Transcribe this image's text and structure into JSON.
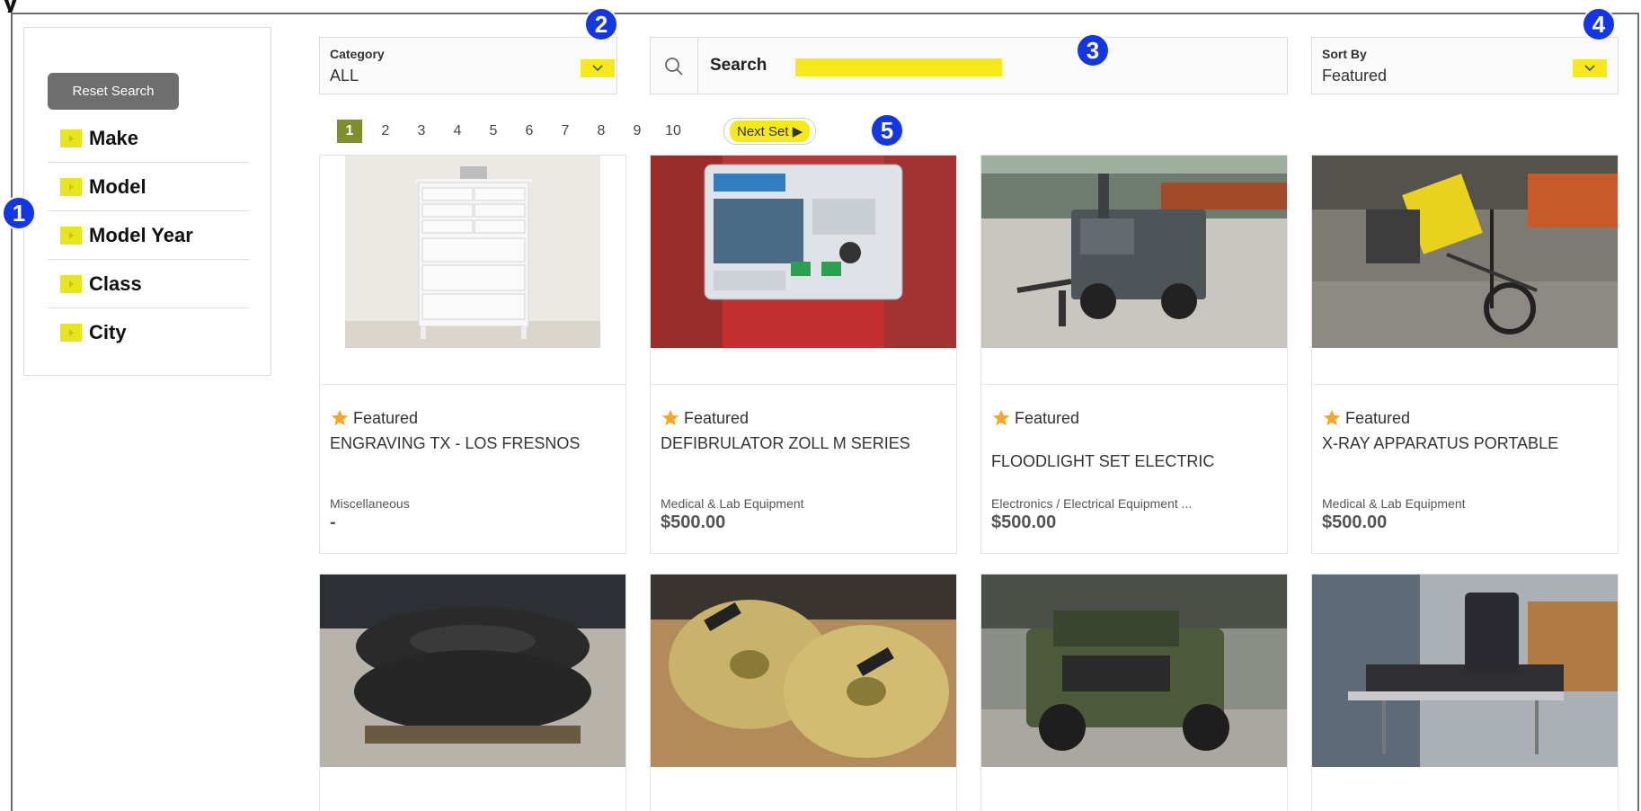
{
  "callouts": [
    "1",
    "2",
    "3",
    "4",
    "5"
  ],
  "sidebar": {
    "reset_label": "Reset Search",
    "filters": [
      {
        "label": "Make"
      },
      {
        "label": "Model"
      },
      {
        "label": "Model Year"
      },
      {
        "label": "Class"
      },
      {
        "label": "City"
      }
    ]
  },
  "category": {
    "caption": "Category",
    "value": "ALL"
  },
  "search": {
    "placeholder": "Search"
  },
  "sort": {
    "caption": "Sort By",
    "value": "Featured"
  },
  "pagination": {
    "pages": [
      "1",
      "2",
      "3",
      "4",
      "5",
      "6",
      "7",
      "8",
      "9",
      "10"
    ],
    "current": "1",
    "next_label": "Next Set ▶"
  },
  "featured_label": "Featured",
  "products": [
    {
      "title": "ENGRAVING TX - LOS FRESNOS",
      "category": "Miscellaneous",
      "price": "-",
      "image_icon": "dresser-photo"
    },
    {
      "title": "DEFIBRULATOR ZOLL M SERIES",
      "category": "Medical & Lab Equipment",
      "price": "$500.00",
      "image_icon": "defibrillator-photo"
    },
    {
      "title": "FLOODLIGHT SET ELECTRIC",
      "category": "Electronics / Electrical Equipment ...",
      "price": "$500.00",
      "image_icon": "floodlight-trailer-photo"
    },
    {
      "title": "X-RAY APPARATUS PORTABLE",
      "category": "Medical & Lab Equipment",
      "price": "$500.00",
      "image_icon": "xray-apparatus-photo"
    },
    {
      "image_icon": "tires-photo"
    },
    {
      "image_icon": "cymbals-photo"
    },
    {
      "image_icon": "humvee-photo"
    },
    {
      "image_icon": "stretcher-photo"
    }
  ],
  "colors": {
    "highlight": "#f5e81b",
    "callout": "#1437e6",
    "active_page": "#7f8f2c",
    "reset_button": "#6e6e6e"
  }
}
